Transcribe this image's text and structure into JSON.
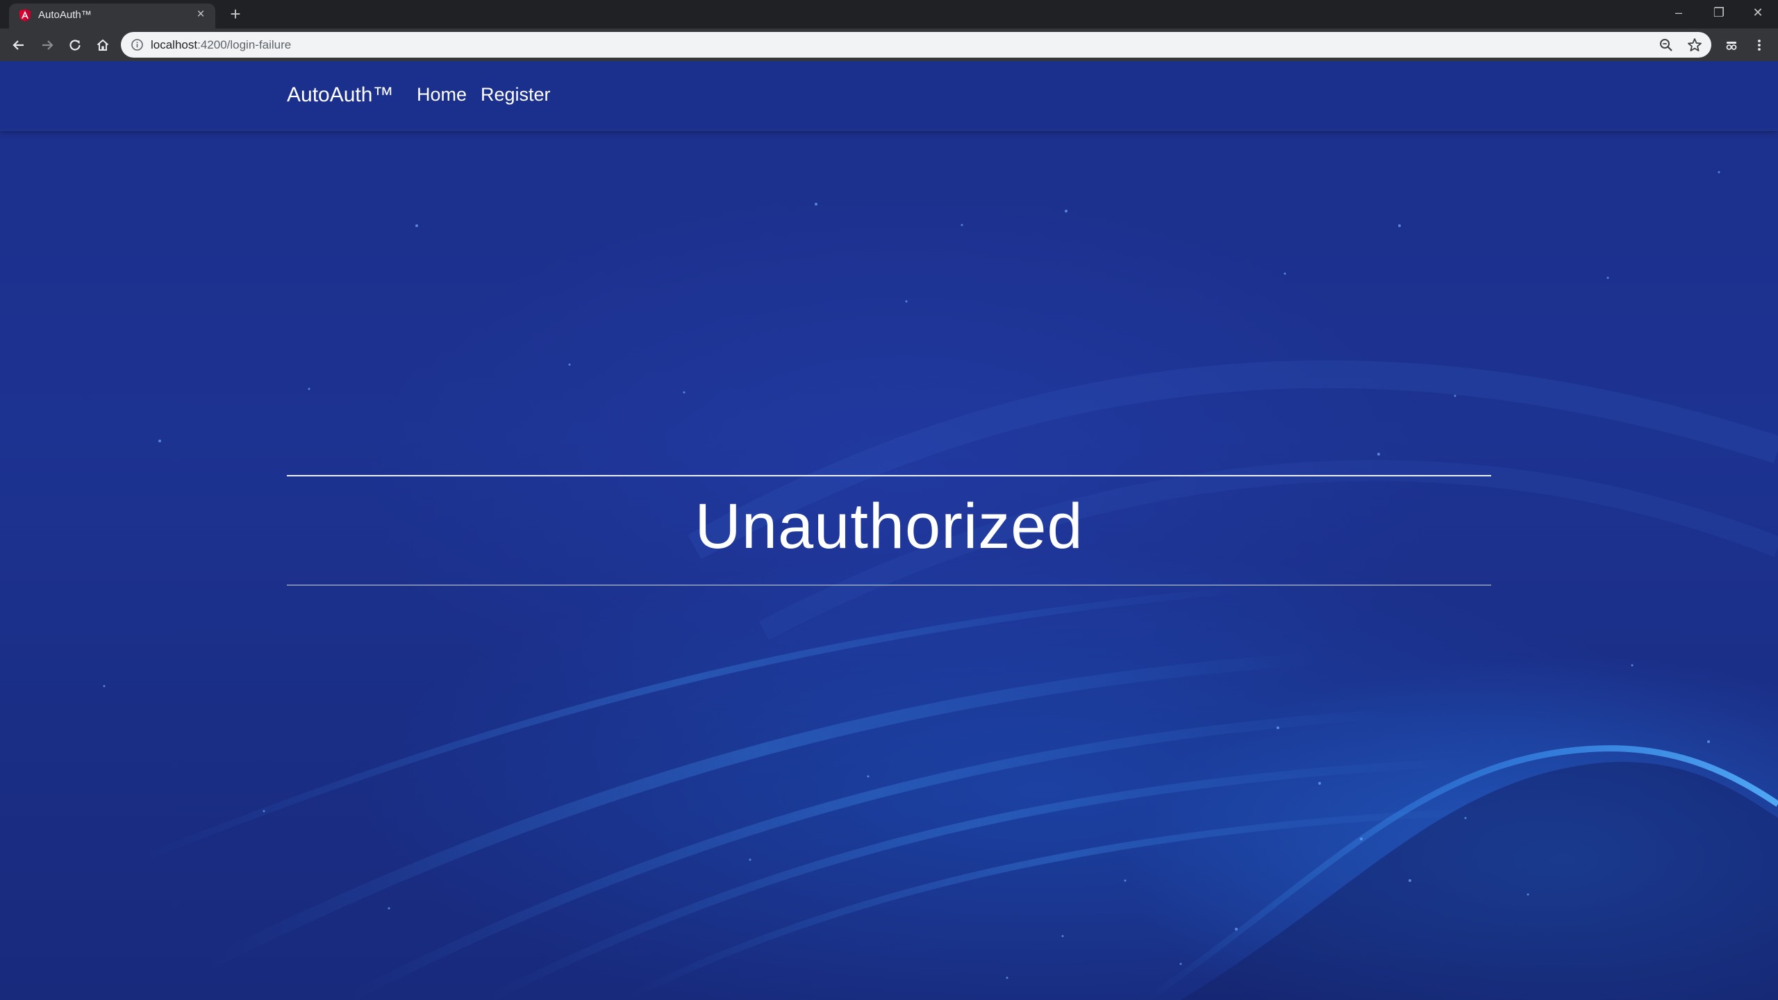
{
  "browser": {
    "tab_title": "AutoAuth™",
    "tab_close": "×",
    "new_tab": "+",
    "url_host": "localhost",
    "url_path": ":4200/login-failure",
    "window_controls": {
      "minimize": "–",
      "restore": "❐",
      "close": "✕"
    },
    "icons": [
      "angular-icon",
      "back-icon",
      "forward-icon",
      "reload-icon",
      "home-icon",
      "info-icon",
      "zoom-icon",
      "star-icon",
      "extension-icon",
      "menu-icon"
    ]
  },
  "navbar": {
    "brand": "AutoAuth™",
    "links": [
      {
        "label": "Home"
      },
      {
        "label": "Register"
      }
    ]
  },
  "main": {
    "heading": "Unauthorized"
  },
  "colors": {
    "background": "#1b2f8a",
    "text": "#ffffff",
    "accent_glow": "#2a7be6"
  }
}
